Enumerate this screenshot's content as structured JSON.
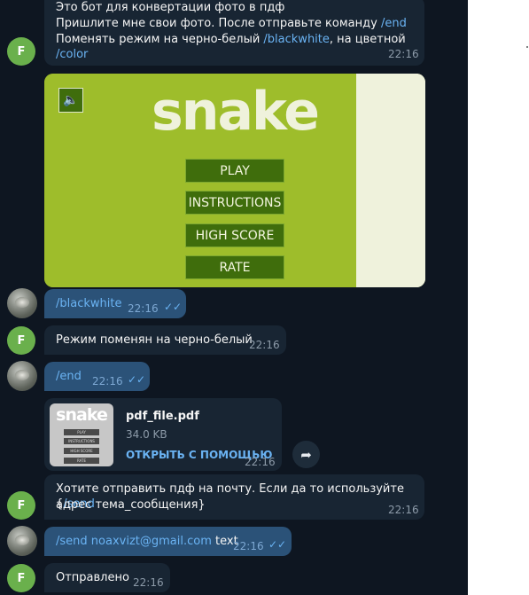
{
  "messages": {
    "intro": {
      "line1": "Это бот для конвертации фото в пдф",
      "line2_text": "Пришлите мне свои фото. После отправьте команду ",
      "line2_cmd": "/end",
      "line3_text": "Поменять режим на черно-белый ",
      "line3_cmd1": "/blackwhite",
      "line3_mid": ", на цветной ",
      "line3_cmd2": "/color",
      "time": "22:16"
    },
    "game": {
      "logo": "snake",
      "buttons": [
        "PLAY",
        "INSTRUCTIONS",
        "HIGH SCORE",
        "RATE"
      ],
      "sound_icon": "speaker-icon",
      "colors": {
        "background": "#9ebd2b",
        "panel": "#eff2dc",
        "button": "#3f6d0c"
      }
    },
    "blackwhite": {
      "text": "/blackwhite",
      "time": "22:16"
    },
    "mode_changed": {
      "text": "Режим поменян на черно-белый",
      "time": "22:16"
    },
    "end": {
      "text": "/end",
      "time": "22:16"
    },
    "file": {
      "name": "pdf_file.pdf",
      "size": "34.0 KB",
      "open_with": "ОТКРЫТЬ С ПОМОЩЬЮ",
      "time": "22:16",
      "thumb_logo": "snake",
      "thumb_buttons": [
        "PLAY",
        "INSTRUCTIONS",
        "HIGH SCORE",
        "RATE"
      ]
    },
    "email_prompt": {
      "line1_text": "Хотите отправить пдф на почту. Если да то используйте {",
      "line1_cmd": "/send",
      "line2": "адрес тема_сообщения}",
      "time": "22:16"
    },
    "send": {
      "cmd": "/send",
      "email": "noaxvizt@gmail.com",
      "rest": " text",
      "time": "22:16"
    },
    "sent": {
      "text": "Отправлено",
      "time": "22:16"
    }
  },
  "avatars": {
    "bot_letter": "F"
  },
  "colors": {
    "chat_bg": "#0e1621",
    "incoming": "#182533",
    "outgoing": "#2b5278",
    "link": "#6ab3f3"
  }
}
